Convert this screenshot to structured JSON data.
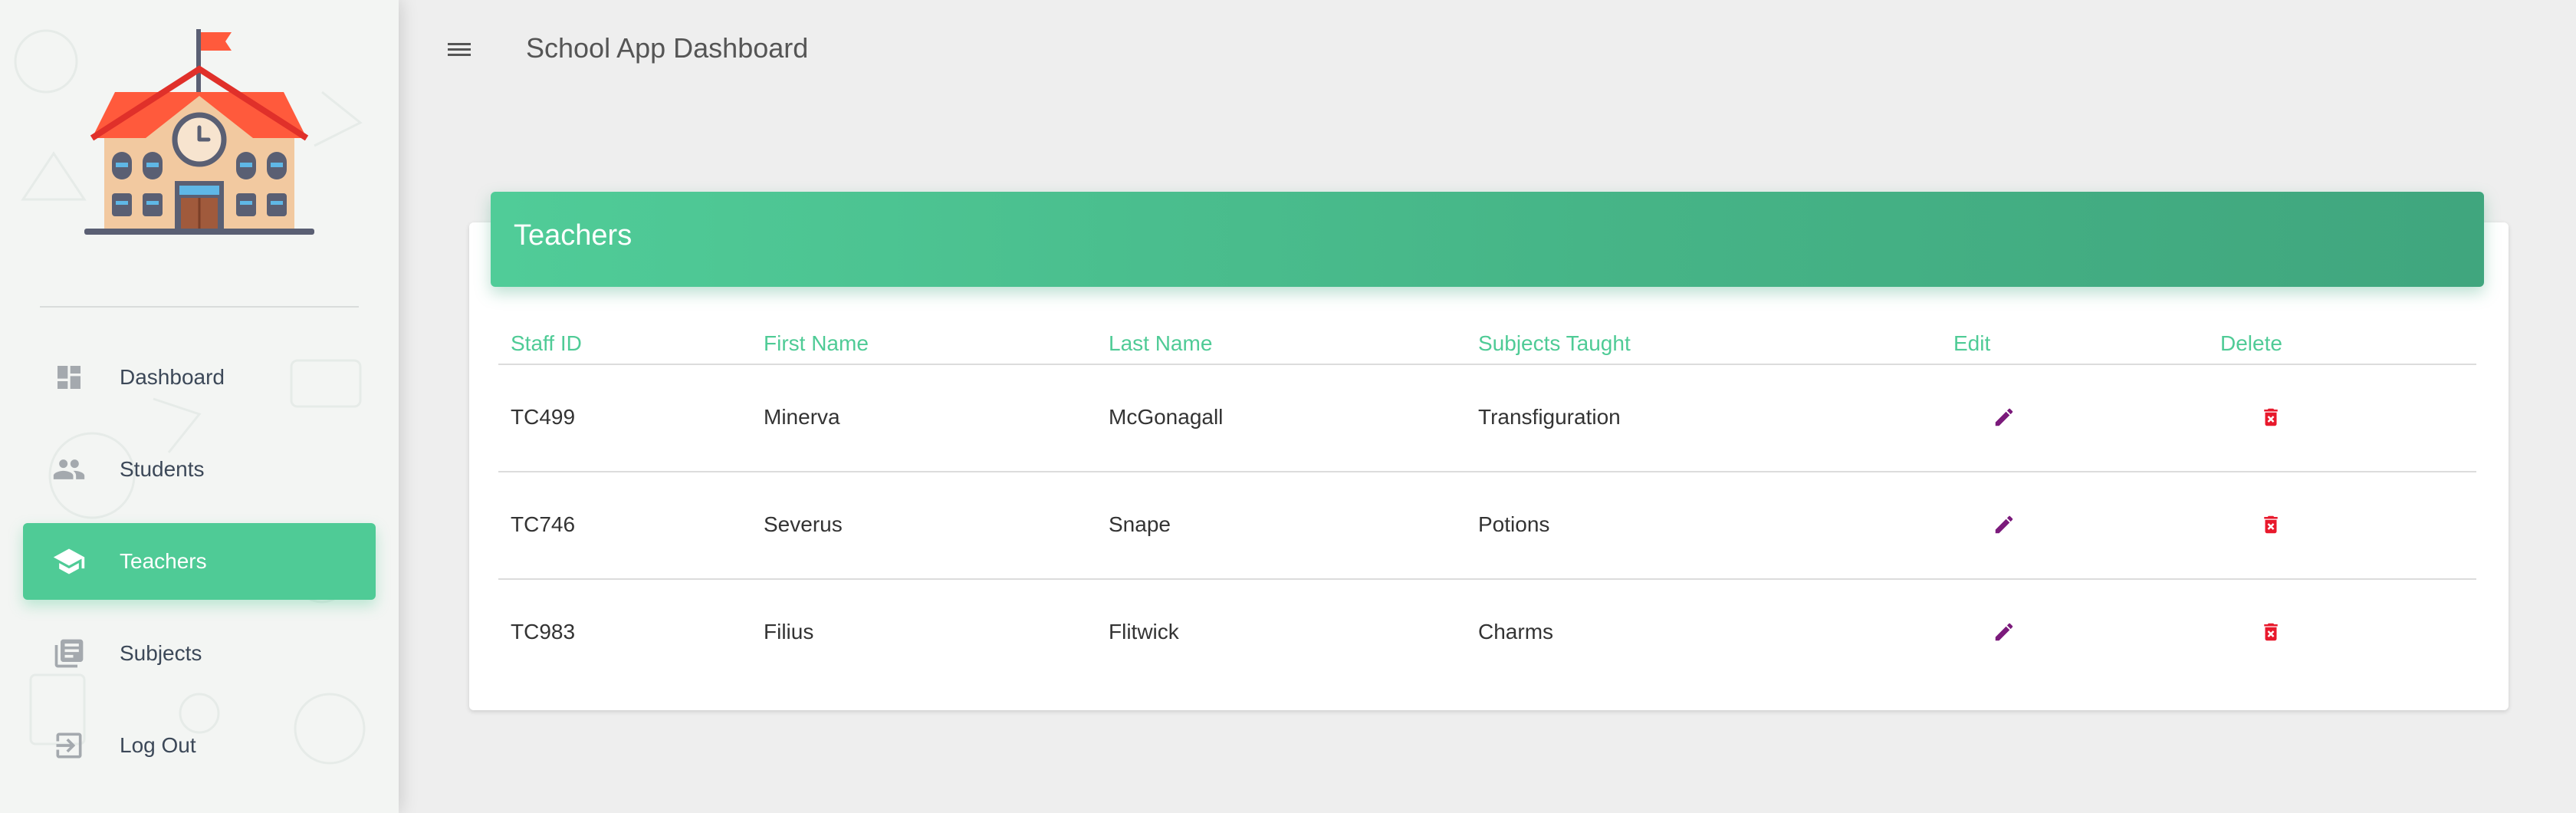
{
  "app": {
    "title": "School App Dashboard"
  },
  "sidebar": {
    "items": [
      {
        "label": "Dashboard",
        "icon": "dashboard-icon",
        "active": false
      },
      {
        "label": "Students",
        "icon": "people-icon",
        "active": false
      },
      {
        "label": "Teachers",
        "icon": "school-icon",
        "active": true
      },
      {
        "label": "Subjects",
        "icon": "library-books-icon",
        "active": false
      },
      {
        "label": "Log Out",
        "icon": "exit-icon",
        "active": false
      }
    ]
  },
  "card": {
    "title": "Teachers",
    "columns": [
      "Staff ID",
      "First Name",
      "Last Name",
      "Subjects Taught",
      "Edit",
      "Delete"
    ],
    "rows": [
      {
        "staff_id": "TC499",
        "first_name": "Minerva",
        "last_name": "McGonagall",
        "subjects": "Transfiguration"
      },
      {
        "staff_id": "TC746",
        "first_name": "Severus",
        "last_name": "Snape",
        "subjects": "Potions"
      },
      {
        "staff_id": "TC983",
        "first_name": "Filius",
        "last_name": "Flitwick",
        "subjects": "Charms"
      }
    ]
  },
  "colors": {
    "accent": "#4fcb96",
    "edit_icon": "#7b1a7b",
    "delete_icon": "#e8192c"
  }
}
